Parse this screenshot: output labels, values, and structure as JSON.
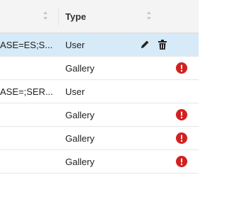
{
  "header": {
    "type_label": "Type"
  },
  "rows": [
    {
      "name": "ASE=ES;S...",
      "type": "User",
      "selected": true,
      "actions": [
        "pencil-icon",
        "trash-icon"
      ],
      "error": false
    },
    {
      "name": "",
      "type": "Gallery",
      "selected": false,
      "actions": [],
      "error": true
    },
    {
      "name": "ASE=;SER...",
      "type": "User",
      "selected": false,
      "actions": [],
      "error": false
    },
    {
      "name": "",
      "type": "Gallery",
      "selected": false,
      "actions": [],
      "error": true
    },
    {
      "name": "",
      "type": "Gallery",
      "selected": false,
      "actions": [],
      "error": true
    },
    {
      "name": "",
      "type": "Gallery",
      "selected": false,
      "actions": [],
      "error": true
    }
  ],
  "colors": {
    "selected_row": "#d6eaf8",
    "error": "#d32020",
    "header_bg": "#f4f4f4"
  }
}
